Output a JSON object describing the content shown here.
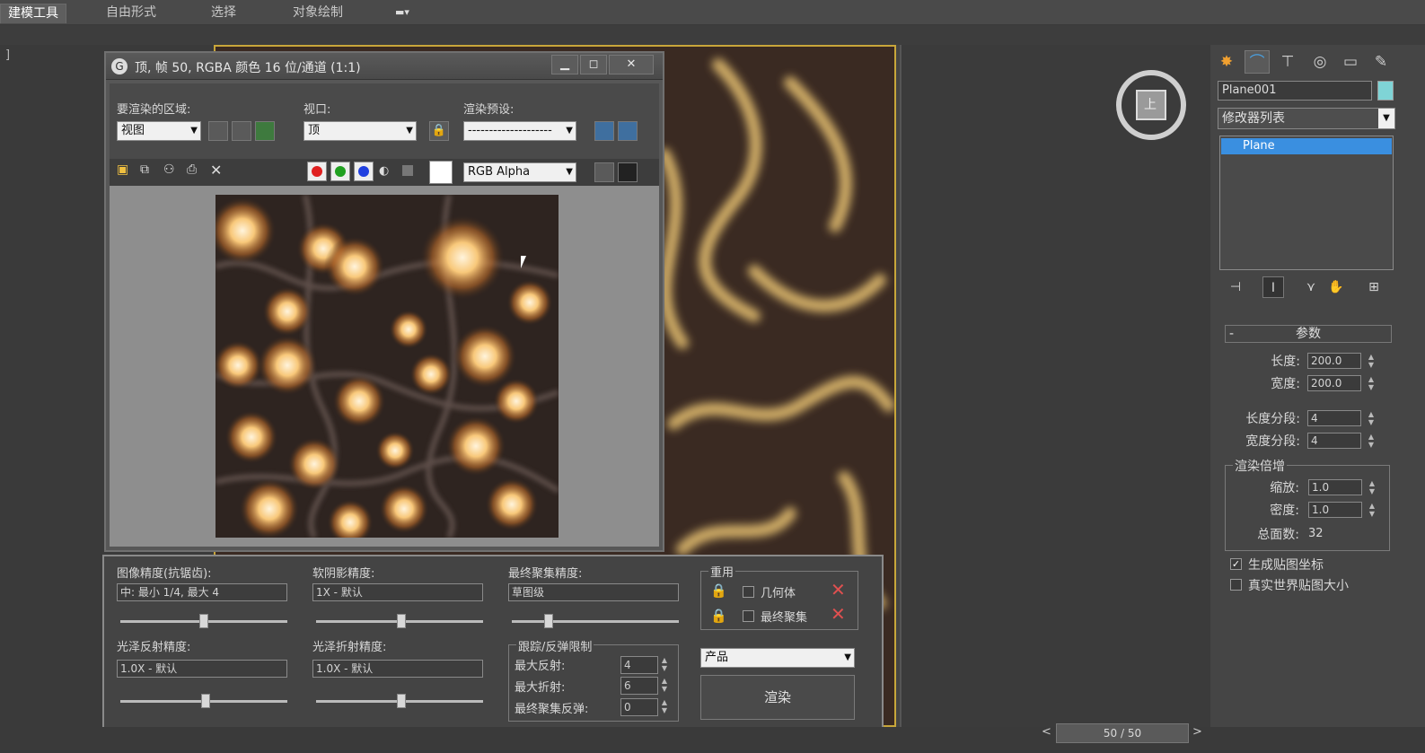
{
  "ribbon": {
    "tabs": [
      "建模工具",
      "自由形式",
      "选择",
      "对象绘制"
    ],
    "extra_icon": "dropdown-menu-icon"
  },
  "left_viewport": {
    "bracket": "]"
  },
  "render_window": {
    "title": "顶, 帧 50, RGBA 颜色 16 位/通道 (1:1)",
    "buttons": {
      "minimize": "▁",
      "restore": "◻",
      "close": "✕"
    },
    "area_label": "要渲染的区域:",
    "area_value": "视图",
    "viewport_label": "视口:",
    "viewport_value": "顶",
    "preset_label": "渲染预设:",
    "preset_value": "--------------------",
    "channel_value": "RGB Alpha",
    "colors": {
      "red": "#e02020",
      "green": "#20a020",
      "blue": "#2040e0"
    }
  },
  "render_setup": {
    "image_precision_label": "图像精度(抗锯齿):",
    "image_precision_value": "中: 最小 1/4, 最大 4",
    "soft_shadow_label": "软阴影精度:",
    "soft_shadow_value": "1X - 默认",
    "final_gather_label": "最终聚集精度:",
    "final_gather_value": "草图级",
    "glossy_reflect_label": "光泽反射精度:",
    "glossy_reflect_value": "1.0X - 默认",
    "glossy_refract_label": "光泽折射精度:",
    "glossy_refract_value": "1.0X - 默认",
    "reuse_group_label": "重用",
    "reuse_geometry_label": "几何体",
    "reuse_final_gather_label": "最终聚集",
    "trace_group_label": "跟踪/反弹限制",
    "max_reflect_label": "最大反射:",
    "max_reflect_value": "4",
    "max_refract_label": "最大折射:",
    "max_refract_value": "6",
    "fg_bounce_label": "最终聚集反弹:",
    "fg_bounce_value": "0",
    "mode_value": "产品",
    "render_button": "渲染",
    "sliders": {
      "image_precision": 0.5,
      "soft_shadow": 0.5,
      "final_gather": 0.2,
      "glossy_reflect": 0.5,
      "glossy_refract": 0.5
    }
  },
  "command_panel": {
    "object_name": "Plane001",
    "object_color": "#7fd4d6",
    "modifier_list_label": "修改器列表",
    "stack_item": "Plane",
    "params_header": "参数",
    "rollout_collapse": "-",
    "length_label": "长度:",
    "length_value": "200.0",
    "width_label": "宽度:",
    "width_value": "200.0",
    "length_segs_label": "长度分段:",
    "length_segs_value": "4",
    "width_segs_label": "宽度分段:",
    "width_segs_value": "4",
    "render_mult_label": "渲染倍增",
    "scale_label": "缩放:",
    "scale_value": "1.0",
    "density_label": "密度:",
    "density_value": "1.0",
    "total_faces_label": "总面数:",
    "total_faces_value": "32",
    "gen_map_coords_label": "生成贴图坐标",
    "gen_map_coords_checked": true,
    "real_world_label": "真实世界贴图大小",
    "real_world_checked": false
  },
  "viewcube": {
    "face_label": "上"
  },
  "timeline": {
    "frame_text": "50 / 50",
    "prev": "<",
    "next": ">"
  }
}
